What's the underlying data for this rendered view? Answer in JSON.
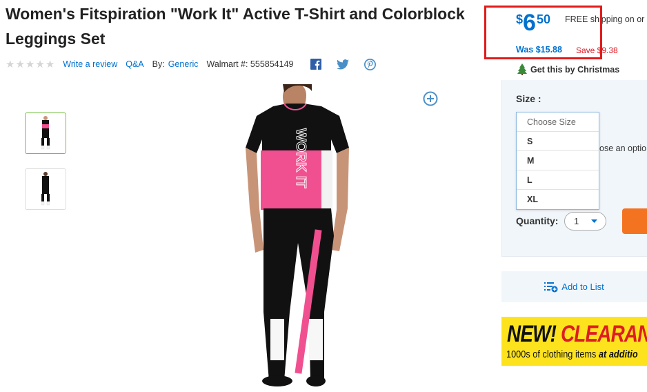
{
  "product": {
    "title": "Women's Fitspiration \"Work It\" Active T-Shirt and Colorblock Leggings Set",
    "write_review": "Write a review",
    "qa": "Q&A",
    "by_label": "By:",
    "brand": "Generic",
    "walmart_number": "Walmart #: 555854149",
    "shirt_text": "WORK IT"
  },
  "social": [
    "facebook-icon",
    "twitter-icon",
    "pinterest-icon"
  ],
  "price": {
    "currency": "$",
    "dollars": "6",
    "cents": "50",
    "free_shipping": "FREE shipping on or",
    "was": "Was $15.88",
    "save": "Save $9.38",
    "christmas": "Get this by Christmas"
  },
  "size": {
    "label": "Size :",
    "options": [
      "Choose Size",
      "S",
      "M",
      "L",
      "XL"
    ],
    "partial_text": "ose an optio"
  },
  "quantity": {
    "label": "Quantity:",
    "value": "1"
  },
  "list": {
    "add_label": "Add to List"
  },
  "banner": {
    "new_text": "NEW!",
    "clearance_text": "CLEARAN",
    "sub_text": "1000s of clothing items",
    "sub_text_em": "at additio"
  },
  "colors": {
    "accent": "#0071ce",
    "sale_red": "#de1c24",
    "highlight_red": "#e21a1a",
    "cart_orange": "#f47321",
    "banner_yellow": "#fde31e",
    "thumb_selected": "#76c043",
    "shirt_pink": "#f0508f"
  }
}
